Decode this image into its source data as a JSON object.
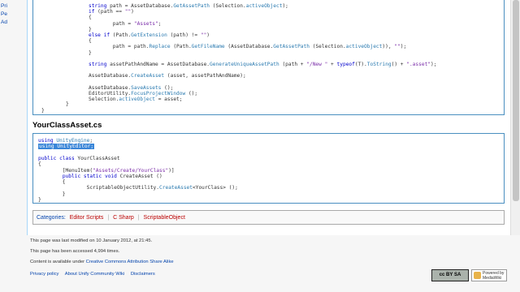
{
  "sidebar": {
    "links": [
      "Pri",
      "Pe",
      "Ad"
    ]
  },
  "code_top": {
    "lines": [
      [
        {
          "t": "string",
          "c": "kw"
        },
        {
          "t": " path = AssetDatabase."
        },
        {
          "t": "GetAssetPath",
          "c": "cls"
        },
        {
          "t": " (Selection."
        },
        {
          "t": "activeObject",
          "c": "cls"
        },
        {
          "t": ");"
        }
      ],
      [
        {
          "t": "if",
          "c": "kw"
        },
        {
          "t": " (path == "
        },
        {
          "t": "\"\"",
          "c": "str"
        },
        {
          "t": ")"
        }
      ],
      [
        {
          "t": "{"
        }
      ],
      [
        {
          "t": "        path = "
        },
        {
          "t": "\"Assets\"",
          "c": "str"
        },
        {
          "t": ";"
        }
      ],
      [
        {
          "t": "}"
        }
      ],
      [
        {
          "t": "else if",
          "c": "kw"
        },
        {
          "t": " (Path."
        },
        {
          "t": "GetExtension",
          "c": "cls"
        },
        {
          "t": " (path) != "
        },
        {
          "t": "\"\"",
          "c": "str"
        },
        {
          "t": ")"
        }
      ],
      [
        {
          "t": "{"
        }
      ],
      [
        {
          "t": "        path = path."
        },
        {
          "t": "Replace",
          "c": "cls"
        },
        {
          "t": " (Path."
        },
        {
          "t": "GetFileName",
          "c": "cls"
        },
        {
          "t": " (AssetDatabase."
        },
        {
          "t": "GetAssetPath",
          "c": "cls"
        },
        {
          "t": " (Selection."
        },
        {
          "t": "activeObject",
          "c": "cls"
        },
        {
          "t": ")), "
        },
        {
          "t": "\"\"",
          "c": "str"
        },
        {
          "t": ");"
        }
      ],
      [
        {
          "t": "}"
        }
      ],
      [
        {
          "t": ""
        }
      ],
      [
        {
          "t": "string",
          "c": "kw"
        },
        {
          "t": " assetPathAndName = AssetDatabase."
        },
        {
          "t": "GenerateUniqueAssetPath",
          "c": "cls"
        },
        {
          "t": " (path + "
        },
        {
          "t": "\"/New \"",
          "c": "str"
        },
        {
          "t": " + "
        },
        {
          "t": "typeof",
          "c": "kw"
        },
        {
          "t": "(T)."
        },
        {
          "t": "ToString",
          "c": "cls"
        },
        {
          "t": "() + "
        },
        {
          "t": "\".asset\"",
          "c": "str"
        },
        {
          "t": ");"
        }
      ],
      [
        {
          "t": ""
        }
      ],
      [
        {
          "t": "AssetDatabase."
        },
        {
          "t": "CreateAsset",
          "c": "cls"
        },
        {
          "t": " (asset, assetPathAndName);"
        }
      ],
      [
        {
          "t": ""
        }
      ],
      [
        {
          "t": "AssetDatabase."
        },
        {
          "t": "SaveAssets",
          "c": "cls"
        },
        {
          "t": " ();"
        }
      ],
      [
        {
          "t": "EditorUtility."
        },
        {
          "t": "FocusProjectWindow",
          "c": "cls"
        },
        {
          "t": " ();"
        }
      ],
      [
        {
          "t": "Selection."
        },
        {
          "t": "activeObject",
          "c": "cls"
        },
        {
          "t": " = asset;"
        }
      ]
    ],
    "closing": [
      "}",
      "}"
    ]
  },
  "section_title": "YourClassAsset.cs",
  "code_bottom": {
    "lines": [
      [
        {
          "t": "using",
          "c": "kw"
        },
        {
          "t": " "
        },
        {
          "t": "UnityEngine",
          "c": "cls"
        },
        {
          "t": ";"
        }
      ],
      [
        {
          "t": "using UnityEditor;",
          "c": "sel"
        }
      ],
      [
        {
          "t": ""
        }
      ],
      [
        {
          "t": "public class",
          "c": "kw"
        },
        {
          "t": " YourClassAsset"
        }
      ],
      [
        {
          "t": "{"
        }
      ],
      [
        {
          "t": "        [MenuItem("
        },
        {
          "t": "\"Assets/Create/YourClass\"",
          "c": "str"
        },
        {
          "t": ")]"
        }
      ],
      [
        {
          "t": "        "
        },
        {
          "t": "public static void",
          "c": "kw"
        },
        {
          "t": " CreateAsset ()"
        }
      ],
      [
        {
          "t": "        {"
        }
      ],
      [
        {
          "t": "                ScriptableObjectUtility."
        },
        {
          "t": "CreateAsset",
          "c": "cls"
        },
        {
          "t": "<YourClass> ();"
        }
      ],
      [
        {
          "t": "        }"
        }
      ],
      [
        {
          "t": "}"
        }
      ]
    ]
  },
  "categories": {
    "label": "Categories:",
    "items": [
      "Editor Scripts",
      "C Sharp",
      "ScriptableObject"
    ]
  },
  "footer": {
    "modified": "This page was last modified on 10 January 2012, at 21:45.",
    "accessed": "This page has been accessed 4,994 times.",
    "license_prefix": "Content is available under ",
    "license_link": "Creative Commons Attribution Share Alike",
    "links": [
      "Privacy policy",
      "About Unify Community Wiki",
      "Disclaimers"
    ]
  },
  "badges": {
    "cc": "cc BY SA",
    "mediawiki": "Powered by MediaWiki"
  }
}
